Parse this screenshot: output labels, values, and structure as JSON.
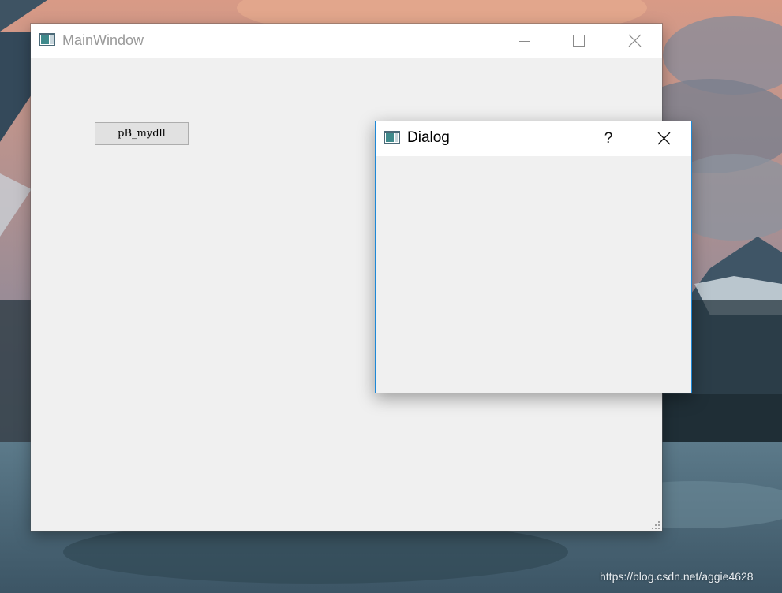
{
  "desktop": {
    "watermark": "https://blog.csdn.net/aggie4628"
  },
  "main_window": {
    "title": "MainWindow",
    "icon": "app-window-icon",
    "controls": [
      "minimize-icon",
      "maximize-icon",
      "close-icon"
    ],
    "push_button_label": "pB_mydll"
  },
  "dialog": {
    "title": "Dialog",
    "icon": "app-window-icon",
    "help_label": "?",
    "close_icon": "close-icon",
    "accent_color": "#1e88d6"
  }
}
